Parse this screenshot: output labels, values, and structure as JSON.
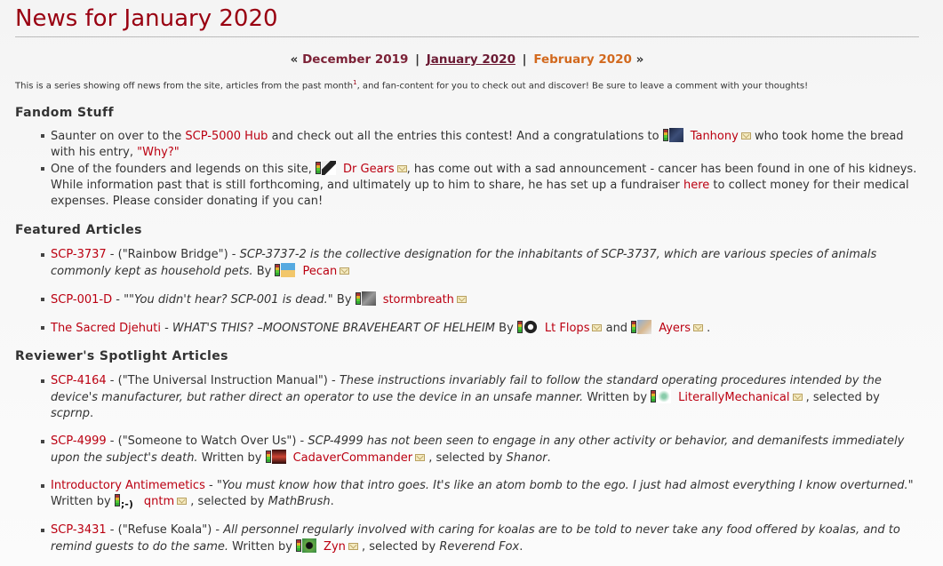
{
  "page": {
    "title": "News for January 2020"
  },
  "month_nav": {
    "prev_arrow": "«",
    "prev_label": "December 2019",
    "separator": "|",
    "current_label": "January 2020",
    "next_label": "February 2020",
    "next_arrow": "»"
  },
  "intro": {
    "text_before": "This is a series showing off news from the site, articles from the past month",
    "footnote": "1",
    "text_after": ", and fan-content for you to check out and discover! Be sure to leave a comment with your thoughts!"
  },
  "sections": {
    "fandom": {
      "heading": "Fandom Stuff",
      "items": [
        {
          "t1": "Saunter on over to the ",
          "link1": "SCP-5000 Hub",
          "t2": " and check out all the entries this contest! And a congratulations to ",
          "user": "Tanhony",
          "t3": " who took home the bread with his entry, ",
          "link2": "\"Why?\""
        },
        {
          "t1": "One of the founders and legends on this site, ",
          "user": "Dr Gears",
          "t2": ", has come out with a sad announcement - cancer has been found in one of his kidneys. While information past that is still forthcoming, and ultimately up to him to share, he has set up a fundraiser ",
          "link1": "here",
          "t3": " to collect money for their medical expenses. Please consider donating if you can!"
        }
      ]
    },
    "featured": {
      "heading": "Featured Articles",
      "items": [
        {
          "link": "SCP-3737",
          "subtitle": " - (\"Rainbow Bridge\") - ",
          "quote": "SCP-3737-2 is the collective designation for the inhabitants of SCP-3737, which are various species of animals commonly kept as household pets.",
          "by": " By ",
          "user": "Pecan"
        },
        {
          "link": "SCP-001-D",
          "subtitle": " - ",
          "quote": "\"\"You didn't hear? SCP-001 is dead.\"",
          "by": " By ",
          "user": "stormbreath"
        },
        {
          "link": "The Sacred Djehuti",
          "subtitle": " - ",
          "quote": "WHAT'S THIS? –MOONSTONE BRAVEHEART OF HELHEIM",
          "by": " By ",
          "user": "Lt Flops",
          "and": " and ",
          "user2": "Ayers",
          "end": " ."
        }
      ]
    },
    "spotlight": {
      "heading": "Reviewer's Spotlight Articles",
      "items": [
        {
          "link": "SCP-4164",
          "subtitle": " - (\"The Universal Instruction Manual\") - ",
          "quote": "These instructions invariably fail to follow the standard operating procedures intended by the device's manufacturer, but rather direct an operator to use the device in an unsafe manner.",
          "written_by": " Written by ",
          "user": "LiterallyMechanical",
          "selected_by": " , selected by ",
          "selector": "scprnp",
          "end": "."
        },
        {
          "link": "SCP-4999",
          "subtitle": " - (\"Someone to Watch Over Us\") - ",
          "quote": "SCP-4999 has not been seen to engage in any other activity or behavior, and demanifests immediately upon the subject's death.",
          "written_by": " Written by ",
          "user": "CadaverCommander",
          "selected_by": " , selected by ",
          "selector": "Shanor",
          "end": "."
        },
        {
          "link": "Introductory Antimemetics",
          "subtitle": " - ",
          "quote": "\"You must know how that intro goes. It's like an atom bomb to the ego. I just had almost everything I know overturned.\"",
          "written_by": " Written by ",
          "user": "qntm",
          "avatar_text": ";-)",
          "selected_by": " , selected by ",
          "selector": "MathBrush",
          "end": "."
        },
        {
          "link": "SCP-3431",
          "subtitle": " - (\"Refuse Koala\") - ",
          "quote": "All personnel regularly involved with caring for koalas are to be told to never take any food offered by koalas, and to remind guests to do the same.",
          "written_by": " Written by ",
          "user": "Zyn",
          "selected_by": " , selected by ",
          "selector": "Reverend Fox",
          "end": "."
        }
      ]
    }
  },
  "colors": {
    "title": "#990011",
    "link": "#bb0011",
    "nav_prev": "#7c2237",
    "nav_next": "#d2691e",
    "text": "#333333"
  },
  "icons": {
    "karma": "karma-bar-icon",
    "envelope": "envelope-icon",
    "bullet": "square-bullet"
  }
}
